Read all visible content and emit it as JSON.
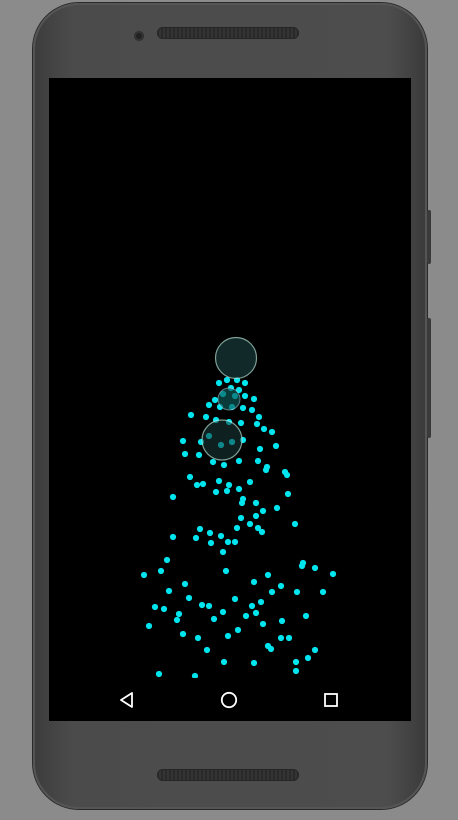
{
  "device": {
    "frame_color": "#4a4a4a",
    "screen_color": "#000000"
  },
  "particles": {
    "color": "#00e5ee",
    "touch_circles": [
      {
        "name": "top-touch-circle"
      },
      {
        "name": "middle-touch-circle"
      },
      {
        "name": "lower-touch-circle"
      }
    ]
  },
  "navigation": {
    "back_icon": "triangle-back-icon",
    "home_icon": "circle-home-icon",
    "recents_icon": "square-recents-icon",
    "icon_color": "#ffffff"
  }
}
